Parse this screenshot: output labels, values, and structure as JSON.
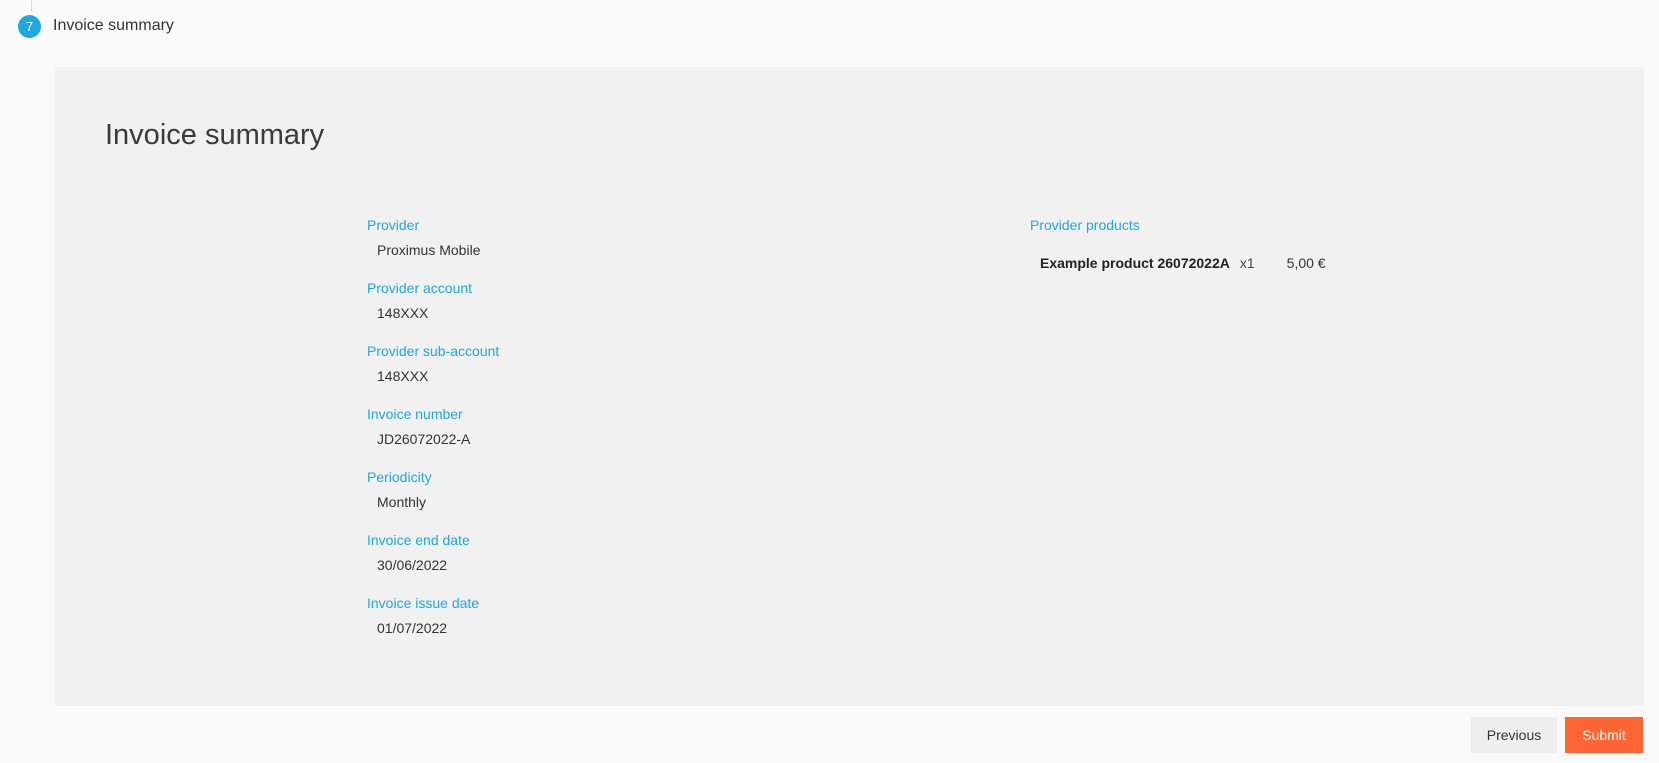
{
  "step": {
    "number": "7",
    "title": "Invoice summary"
  },
  "panel": {
    "title": "Invoice summary"
  },
  "fields": [
    {
      "label": "Provider",
      "value": "Proximus Mobile"
    },
    {
      "label": "Provider account",
      "value": "148XXX"
    },
    {
      "label": "Provider sub-account",
      "value": "148XXX"
    },
    {
      "label": "Invoice number",
      "value": "JD26072022-A"
    },
    {
      "label": "Periodicity",
      "value": "Monthly"
    },
    {
      "label": "Invoice end date",
      "value": "30/06/2022"
    },
    {
      "label": "Invoice issue date",
      "value": "01/07/2022"
    }
  ],
  "products": {
    "label": "Provider products",
    "items": [
      {
        "name": "Example product 26072022A",
        "quantity": "x1",
        "price": "5,00 €"
      }
    ]
  },
  "actions": {
    "previous_label": "Previous",
    "submit_label": "Submit"
  },
  "colors": {
    "accent": "#1ea7e1",
    "submit": "#ff6433",
    "panel_bg": "#f1f1f1",
    "page_bg": "#fafafa"
  }
}
